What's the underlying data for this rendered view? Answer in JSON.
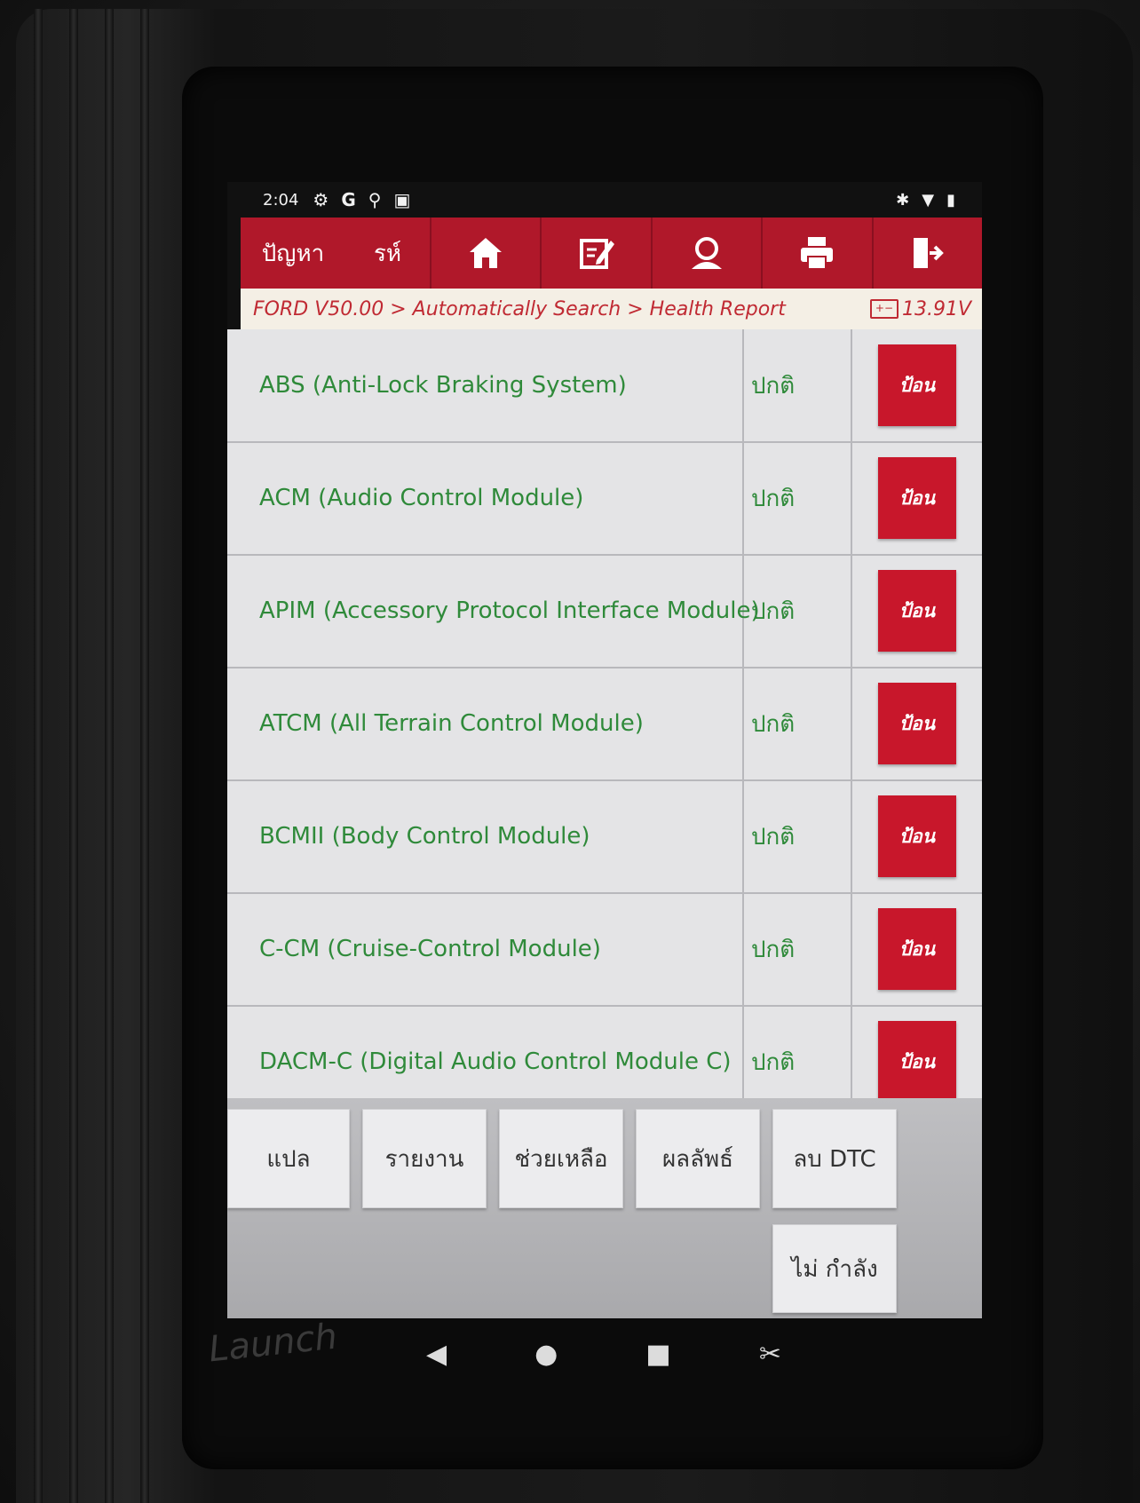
{
  "status_bar": {
    "time": "2:04",
    "left_icons": [
      "settings-gear-icon",
      "google-icon",
      "usb-icon",
      "image-icon"
    ],
    "right_icons": [
      "bluetooth-icon",
      "wifi-icon",
      "battery-icon"
    ]
  },
  "top_nav": {
    "label_1": "ปัญหา",
    "label_2": "รห์",
    "buttons": [
      "home-icon",
      "edit-icon",
      "user-icon",
      "print-icon",
      "exit-icon"
    ]
  },
  "breadcrumb": {
    "path": "FORD V50.00 > Automatically Search > Health Report",
    "voltage": "13.91V"
  },
  "modules": [
    {
      "name": "ABS (Anti-Lock Braking System)",
      "status": "ปกติ",
      "action": "ป้อน"
    },
    {
      "name": "ACM (Audio Control Module)",
      "status": "ปกติ",
      "action": "ป้อน"
    },
    {
      "name": "APIM (Accessory Protocol Interface Module)",
      "status": "ปกติ",
      "action": "ป้อน"
    },
    {
      "name": "ATCM (All Terrain Control Module)",
      "status": "ปกติ",
      "action": "ป้อน"
    },
    {
      "name": "BCMII (Body Control Module)",
      "status": "ปกติ",
      "action": "ป้อน"
    },
    {
      "name": "C-CM (Cruise-Control Module)",
      "status": "ปกติ",
      "action": "ป้อน"
    },
    {
      "name": "DACM-C (Digital Audio Control Module C)",
      "status": "ปกติ",
      "action": "ป้อน"
    }
  ],
  "toolbar": {
    "translate": "แปล",
    "report": "รายงาน",
    "help": "ช่วยเหลือ",
    "result": "ผลลัพธ์",
    "clear_dtc": "ลบ DTC",
    "in_progress": "ไม่ กำลัง"
  },
  "system_nav": [
    "back-icon",
    "home-circle-icon",
    "recents-icon",
    "screenshot-icon"
  ],
  "colors": {
    "nav_red": "#b0182a",
    "button_red": "#c8172b",
    "text_green": "#2f8a3a",
    "crumb_red": "#c02a33"
  }
}
